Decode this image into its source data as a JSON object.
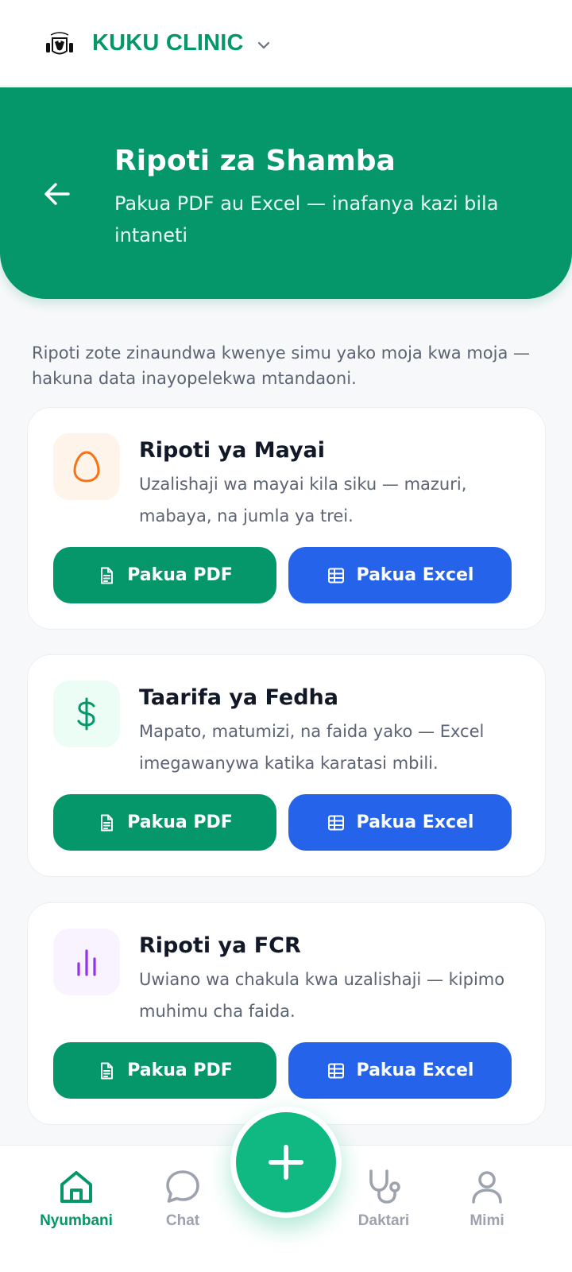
{
  "app": {
    "name": "KUKU CLINIC",
    "logo_icon": "rooster-logo-icon",
    "switcher_icon": "chevron-down-icon"
  },
  "header": {
    "title": "Ripoti za Shamba",
    "subtitle": "Pakua PDF au Excel — inafanya kazi bila intaneti",
    "back_icon": "arrow-left-icon"
  },
  "intro_text": "Ripoti zote zinaundwa kwenye simu yako moja kwa moja — hakuna data inayopelekwa mtandaoni.",
  "reports": [
    {
      "title": "Ripoti ya Mayai",
      "description": "Uzalishaji wa mayai kila siku — mazuri, mabaya, na jumla ya trei.",
      "icon": "egg-icon",
      "pdf_label": "Pakua PDF",
      "excel_label": "Pakua Excel"
    },
    {
      "title": "Taarifa ya Fedha",
      "description": "Mapato, matumizi, na faida yako — Excel imegawanywa katika karatasi mbili.",
      "icon": "dollar-icon",
      "pdf_label": "Pakua PDF",
      "excel_label": "Pakua Excel"
    },
    {
      "title": "Ripoti ya FCR",
      "description": "Uwiano wa chakula kwa uzalishaji — kipimo muhimu cha faida.",
      "icon": "bar-chart-icon",
      "pdf_label": "Pakua PDF",
      "excel_label": "Pakua Excel"
    }
  ],
  "bottom_nav": {
    "items": [
      {
        "label": "Nyumbani",
        "icon": "home-icon",
        "active": true
      },
      {
        "label": "Chat",
        "icon": "chat-icon",
        "active": false
      },
      {
        "label": "Daktari",
        "icon": "stethoscope-icon",
        "active": false
      },
      {
        "label": "Mimi",
        "icon": "user-icon",
        "active": false
      }
    ],
    "fab_icon": "plus-icon"
  },
  "colors": {
    "primary_green": "#059669",
    "fab_green": "#10b981",
    "excel_blue": "#2563eb",
    "egg_orange": "#f97316",
    "fcr_purple": "#9333ea",
    "inactive_gray": "#9ca3af"
  }
}
